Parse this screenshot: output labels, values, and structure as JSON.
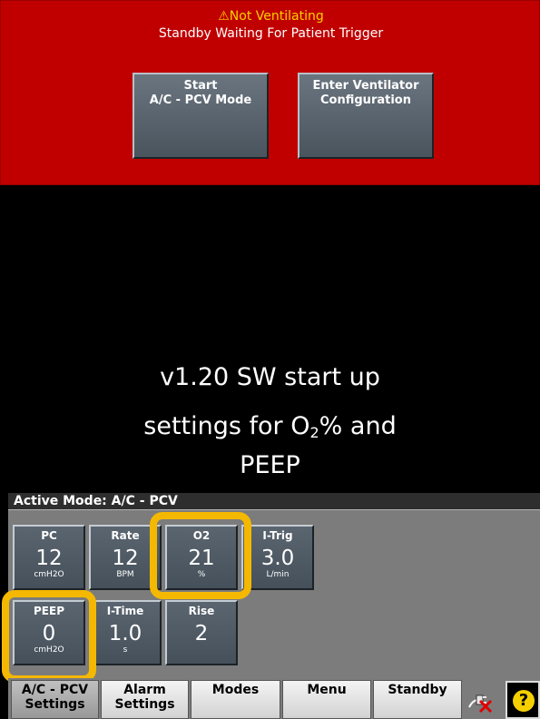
{
  "alarm": {
    "title": "⚠Not Ventilating",
    "subtitle": "Standby Waiting For Patient Trigger"
  },
  "buttons": {
    "start_line1": "Start",
    "start_line2": "A/C - PCV Mode",
    "config_line1": "Enter Ventilator",
    "config_line2": "Configuration"
  },
  "annotation": {
    "line1": "v1.20 SW start up",
    "line2_pre": "settings for O",
    "line2_sub": "2",
    "line2_post": "% and",
    "line3": "PEEP"
  },
  "active_mode": "Active Mode: A/C - PCV",
  "settings": {
    "pc": {
      "label": "PC",
      "value": "12",
      "unit": "cmH2O"
    },
    "rate": {
      "label": "Rate",
      "value": "12",
      "unit": "BPM"
    },
    "o2": {
      "label": "O2",
      "value": "21",
      "unit": "%"
    },
    "itrig": {
      "label": "I-Trig",
      "value": "3.0",
      "unit": "L/min"
    },
    "peep": {
      "label": "PEEP",
      "value": "0",
      "unit": "cmH2O"
    },
    "itime": {
      "label": "I-Time",
      "value": "1.0",
      "unit": "s"
    },
    "rise": {
      "label": "Rise",
      "value": "2",
      "unit": ""
    }
  },
  "tabs": {
    "ac_pcv_line1": "A/C - PCV",
    "ac_pcv_line2": "Settings",
    "alarm_line1": "Alarm",
    "alarm_line2": "Settings",
    "modes": "Modes",
    "menu": "Menu",
    "standby": "Standby"
  },
  "help_symbol": "?",
  "colors": {
    "alarm_banner": "#c00000",
    "alarm_text": "#f5d000",
    "highlight": "#f5b800",
    "panel": "#7c7c7c"
  },
  "icons": [
    "warning-icon",
    "power-disconnected-icon",
    "help-icon"
  ]
}
